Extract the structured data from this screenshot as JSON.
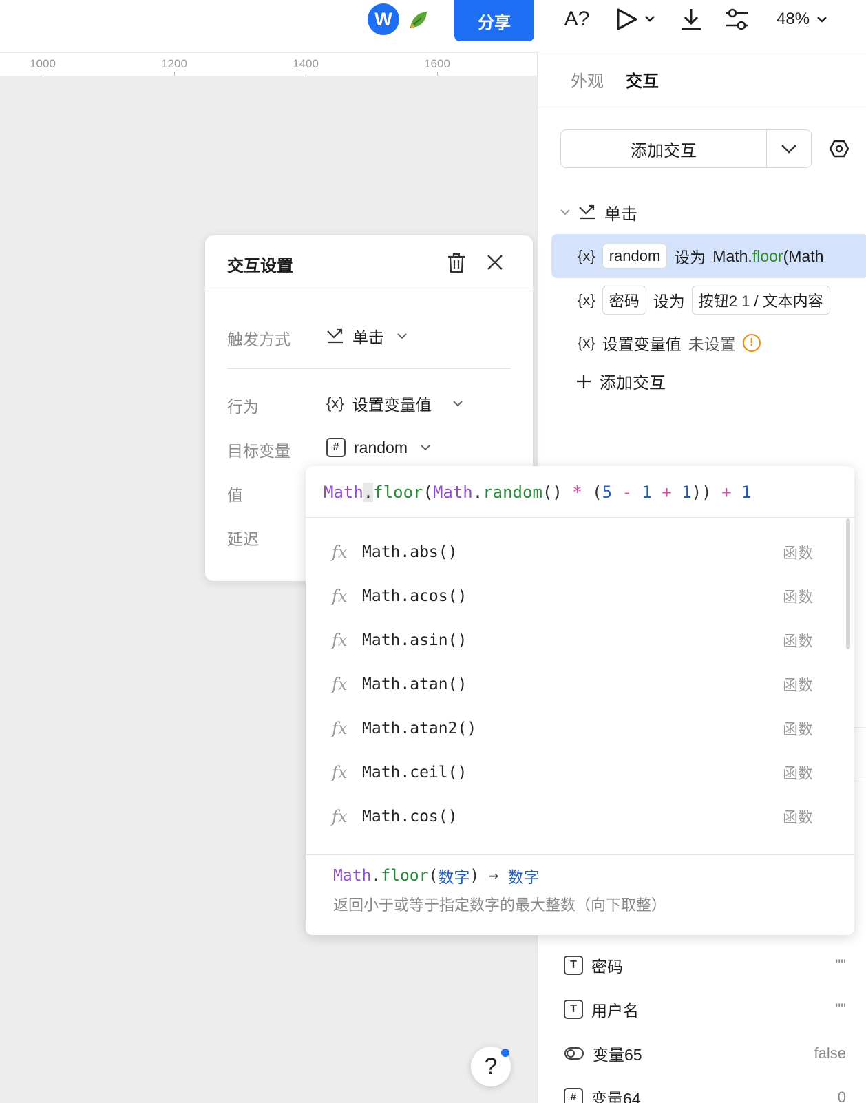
{
  "topbar": {
    "avatar_letter": "W",
    "share_label": "分享",
    "font_check_label": "A?",
    "zoom_label": "48%"
  },
  "ruler": {
    "ticks": [
      "1000",
      "1200",
      "1400",
      "1600"
    ]
  },
  "panel": {
    "tabs": [
      "外观",
      "交互"
    ],
    "active_tab": "交互",
    "add_interaction_label": "添加交互",
    "trigger_label": "单击",
    "actions": [
      {
        "var_glyph": "{x}",
        "target": "random",
        "verb": "设为",
        "value_prefix": "Math.",
        "value_fn": "floor",
        "value_suffix": "(Math"
      },
      {
        "var_glyph": "{x}",
        "target": "密码",
        "verb": "设为",
        "value": "按钮2 1 / 文本内容"
      },
      {
        "var_glyph": "{x}",
        "label": "设置变量值",
        "status": "未设置"
      }
    ],
    "add_action_label": "添加交互",
    "variables": [
      {
        "icon": "T",
        "name": "密码",
        "value": "\"\""
      },
      {
        "icon": "T",
        "name": "用户名",
        "value": "\"\""
      },
      {
        "icon": "toggle",
        "name": "变量65",
        "value": "false"
      },
      {
        "icon": "#",
        "name": "变量64",
        "value": "0"
      }
    ]
  },
  "dialog": {
    "title": "交互设置",
    "trigger_label": "触发方式",
    "trigger_value": "单击",
    "behavior_label": "行为",
    "behavior_glyph": "{x}",
    "behavior_value": "设置变量值",
    "target_label": "目标变量",
    "target_value": "random",
    "value_label": "值",
    "delay_label": "延迟"
  },
  "popup": {
    "expression_tokens": [
      {
        "t": "Math",
        "c": "purple"
      },
      {
        "t": ".",
        "c": "plain",
        "caret": true
      },
      {
        "t": "floor",
        "c": "green"
      },
      {
        "t": "(",
        "c": "plain"
      },
      {
        "t": "Math",
        "c": "purple"
      },
      {
        "t": ".",
        "c": "plain"
      },
      {
        "t": "random",
        "c": "green"
      },
      {
        "t": "() ",
        "c": "plain"
      },
      {
        "t": "*",
        "c": "pink"
      },
      {
        "t": " (",
        "c": "plain"
      },
      {
        "t": "5",
        "c": "blue"
      },
      {
        "t": " - ",
        "c": "pink"
      },
      {
        "t": "1",
        "c": "blue"
      },
      {
        "t": " + ",
        "c": "pink"
      },
      {
        "t": "1",
        "c": "blue"
      },
      {
        "t": ")) ",
        "c": "plain"
      },
      {
        "t": "+",
        "c": "pink"
      },
      {
        "t": " 1",
        "c": "blue"
      }
    ],
    "suggestions": [
      {
        "icon": "fx",
        "name": "Math.abs()",
        "kind": "函数"
      },
      {
        "icon": "fx",
        "name": "Math.acos()",
        "kind": "函数"
      },
      {
        "icon": "fx",
        "name": "Math.asin()",
        "kind": "函数"
      },
      {
        "icon": "fx",
        "name": "Math.atan()",
        "kind": "函数"
      },
      {
        "icon": "fx",
        "name": "Math.atan2()",
        "kind": "函数"
      },
      {
        "icon": "fx",
        "name": "Math.ceil()",
        "kind": "函数"
      },
      {
        "icon": "fx",
        "name": "Math.cos()",
        "kind": "函数"
      }
    ],
    "signature": {
      "obj": "Math",
      "dot": ".",
      "fn": "floor",
      "open": "(",
      "param": "数字",
      "close": ")",
      "arrow": " → ",
      "ret": "数字"
    },
    "description": "返回小于或等于指定数字的最大整数（向下取整）"
  },
  "help": {
    "label": "?"
  },
  "colors": {
    "accent": "#1d6ef3",
    "selected_row": "#d4e3fb",
    "warning": "#f08c10"
  }
}
